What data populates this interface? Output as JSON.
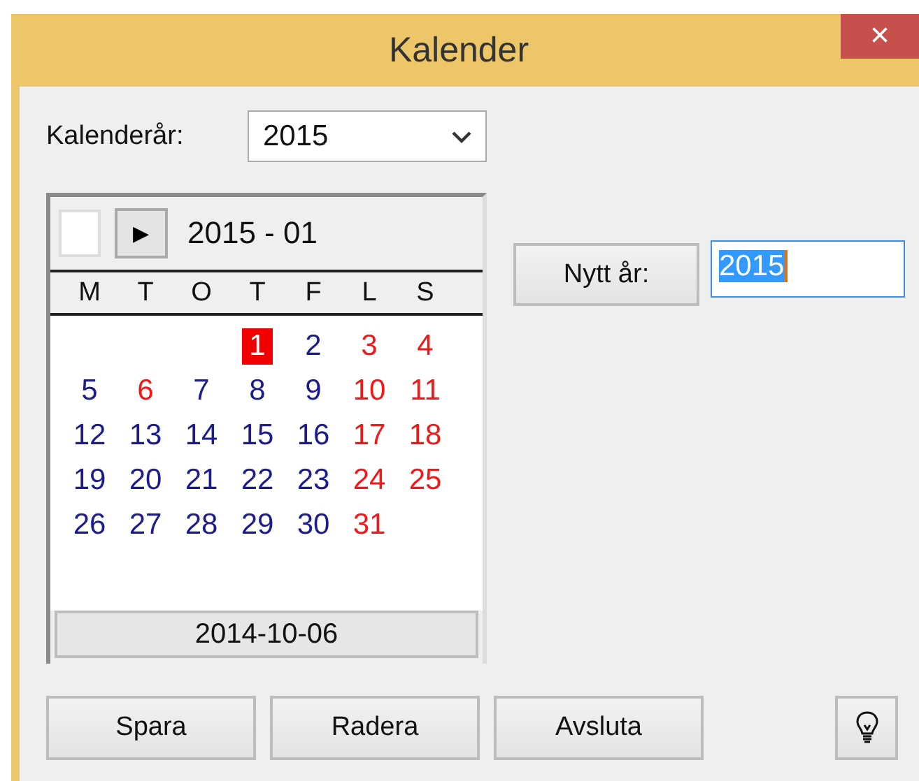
{
  "window": {
    "title": "Kalender",
    "close": "×"
  },
  "year_label": "Kalenderår:",
  "year_select": {
    "value": "2015"
  },
  "calendar": {
    "nav": "▶",
    "month": "2015 - 01",
    "weekdays": [
      "M",
      "T",
      "O",
      "T",
      "F",
      "L",
      "S"
    ],
    "weeks": [
      [
        {
          "day": "1",
          "holiday": false,
          "selected": true
        },
        {
          "day": "2",
          "holiday": false,
          "selected": false
        },
        {
          "day": "3",
          "holiday": true,
          "selected": false
        },
        {
          "day": "4",
          "holiday": true,
          "selected": false
        }
      ],
      [
        {
          "day": "5",
          "holiday": false,
          "selected": false
        },
        {
          "day": "6",
          "holiday": true,
          "selected": false
        },
        {
          "day": "7",
          "holiday": false,
          "selected": false
        },
        {
          "day": "8",
          "holiday": false,
          "selected": false
        },
        {
          "day": "9",
          "holiday": false,
          "selected": false
        },
        {
          "day": "10",
          "holiday": true,
          "selected": false
        },
        {
          "day": "11",
          "holiday": true,
          "selected": false
        }
      ],
      [
        {
          "day": "12",
          "holiday": false,
          "selected": false
        },
        {
          "day": "13",
          "holiday": false,
          "selected": false
        },
        {
          "day": "14",
          "holiday": false,
          "selected": false
        },
        {
          "day": "15",
          "holiday": false,
          "selected": false
        },
        {
          "day": "16",
          "holiday": false,
          "selected": false
        },
        {
          "day": "17",
          "holiday": true,
          "selected": false
        },
        {
          "day": "18",
          "holiday": true,
          "selected": false
        }
      ],
      [
        {
          "day": "19",
          "holiday": false,
          "selected": false
        },
        {
          "day": "20",
          "holiday": false,
          "selected": false
        },
        {
          "day": "21",
          "holiday": false,
          "selected": false
        },
        {
          "day": "22",
          "holiday": false,
          "selected": false
        },
        {
          "day": "23",
          "holiday": false,
          "selected": false
        },
        {
          "day": "24",
          "holiday": true,
          "selected": false
        },
        {
          "day": "25",
          "holiday": true,
          "selected": false
        }
      ],
      [
        {
          "day": "26",
          "holiday": false,
          "selected": false
        },
        {
          "day": "27",
          "holiday": false,
          "selected": false
        },
        {
          "day": "28",
          "holiday": false,
          "selected": false
        },
        {
          "day": "29",
          "holiday": false,
          "selected": false
        },
        {
          "day": "30",
          "holiday": false,
          "selected": false
        },
        {
          "day": "31",
          "holiday": true,
          "selected": false
        }
      ]
    ],
    "today": "2014-10-06"
  },
  "new_year": {
    "button": "Nytt år:",
    "value": "2015"
  },
  "buttons": [
    "Spara",
    "Radera",
    "Avsluta"
  ]
}
